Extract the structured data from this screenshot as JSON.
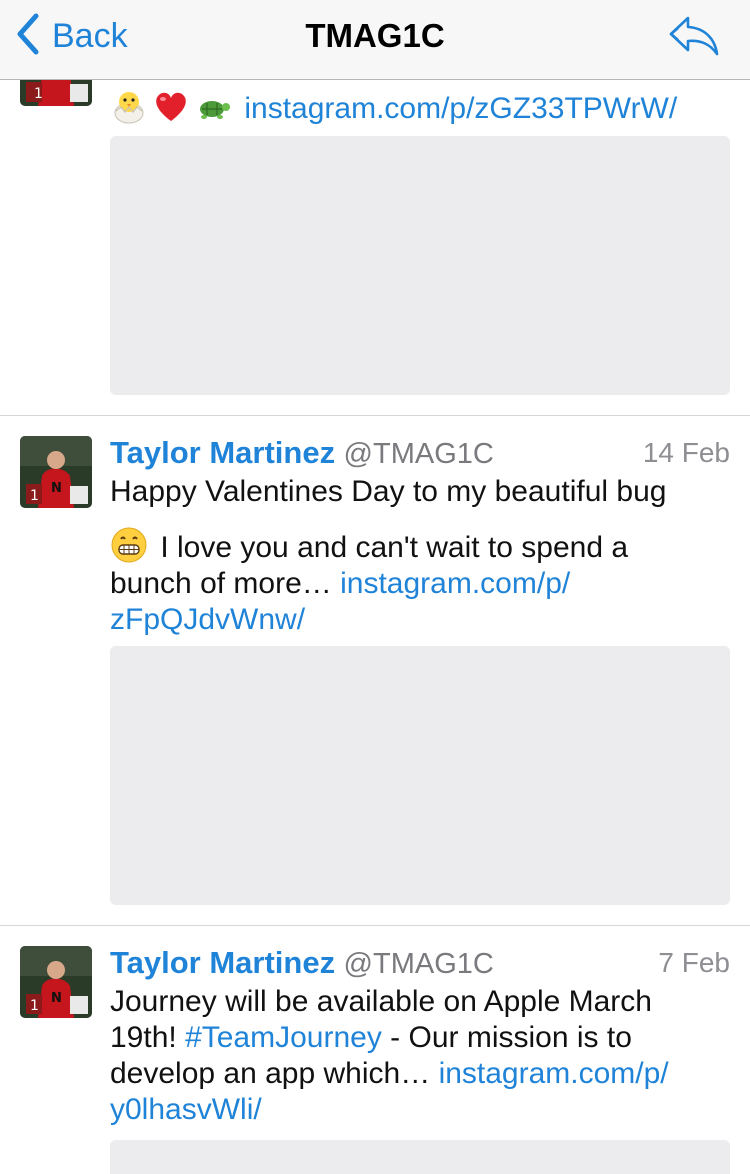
{
  "navbar": {
    "back_label": "Back",
    "title": "TMAG1C",
    "reply_icon": "reply-arrow-icon",
    "accent_color": "#1f83d8"
  },
  "tweets": [
    {
      "emojis": [
        "hatching-chick-emoji",
        "red-heart-emoji",
        "turtle-emoji"
      ],
      "link": "instagram.com/p/zGZ33TPWrW/"
    },
    {
      "name": "Taylor Martinez",
      "handle": "@TMAG1C",
      "date": "14 Feb",
      "line1": "Happy Valentines Day to my beautiful bug",
      "emoji": "grinning-face-emoji",
      "line2": " I love you and can't wait to spend a",
      "line3": "bunch of more… ",
      "link1": "instagram.com/p/",
      "link2": "zFpQJdvWnw/"
    },
    {
      "name": "Taylor Martinez",
      "handle": "@TMAG1C",
      "date": "7 Feb",
      "line1": "Journey will be available on Apple March",
      "line2a": "19th! ",
      "hashtag": "#TeamJourney",
      "line2b": " - Our mission is to",
      "line3": "develop an app which… ",
      "link1": "instagram.com/p/",
      "link2": "y0lhasvWli/"
    }
  ]
}
